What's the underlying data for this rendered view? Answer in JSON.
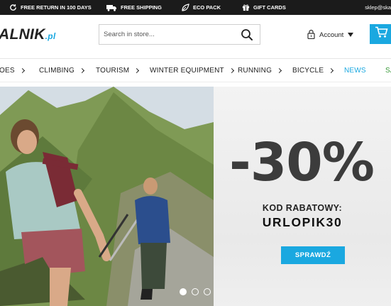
{
  "topbar": {
    "items": [
      {
        "label": "FREE RETURN IN 100 DAYS",
        "icon": "return-icon"
      },
      {
        "label": "FREE SHIPPING",
        "icon": "truck-icon"
      },
      {
        "label": "ECO PACK",
        "icon": "leaf-icon"
      },
      {
        "label": "GIFT CARDS",
        "icon": "gift-icon"
      }
    ],
    "email": "sklep@ska"
  },
  "header": {
    "logo_main": "ALNIK",
    "logo_suffix": ".pl",
    "search_placeholder": "Search in store...",
    "account_label": "Account"
  },
  "nav": {
    "items": [
      "OES",
      "CLIMBING",
      "TOURISM",
      "WINTER EQUIPMENT",
      "RUNNING",
      "BICYCLE"
    ],
    "news": "NEWS",
    "sale": "SA"
  },
  "hero": {
    "discount": "-30%",
    "kod_label": "KOD RABATOWY:",
    "code": "URLOPIK30",
    "cta": "SPRAWDŹ",
    "slides": 3,
    "active_slide": 1
  },
  "colors": {
    "accent": "#1aa8e0",
    "topbar_bg": "#1b1b1b",
    "sale": "#3a9a3a"
  }
}
